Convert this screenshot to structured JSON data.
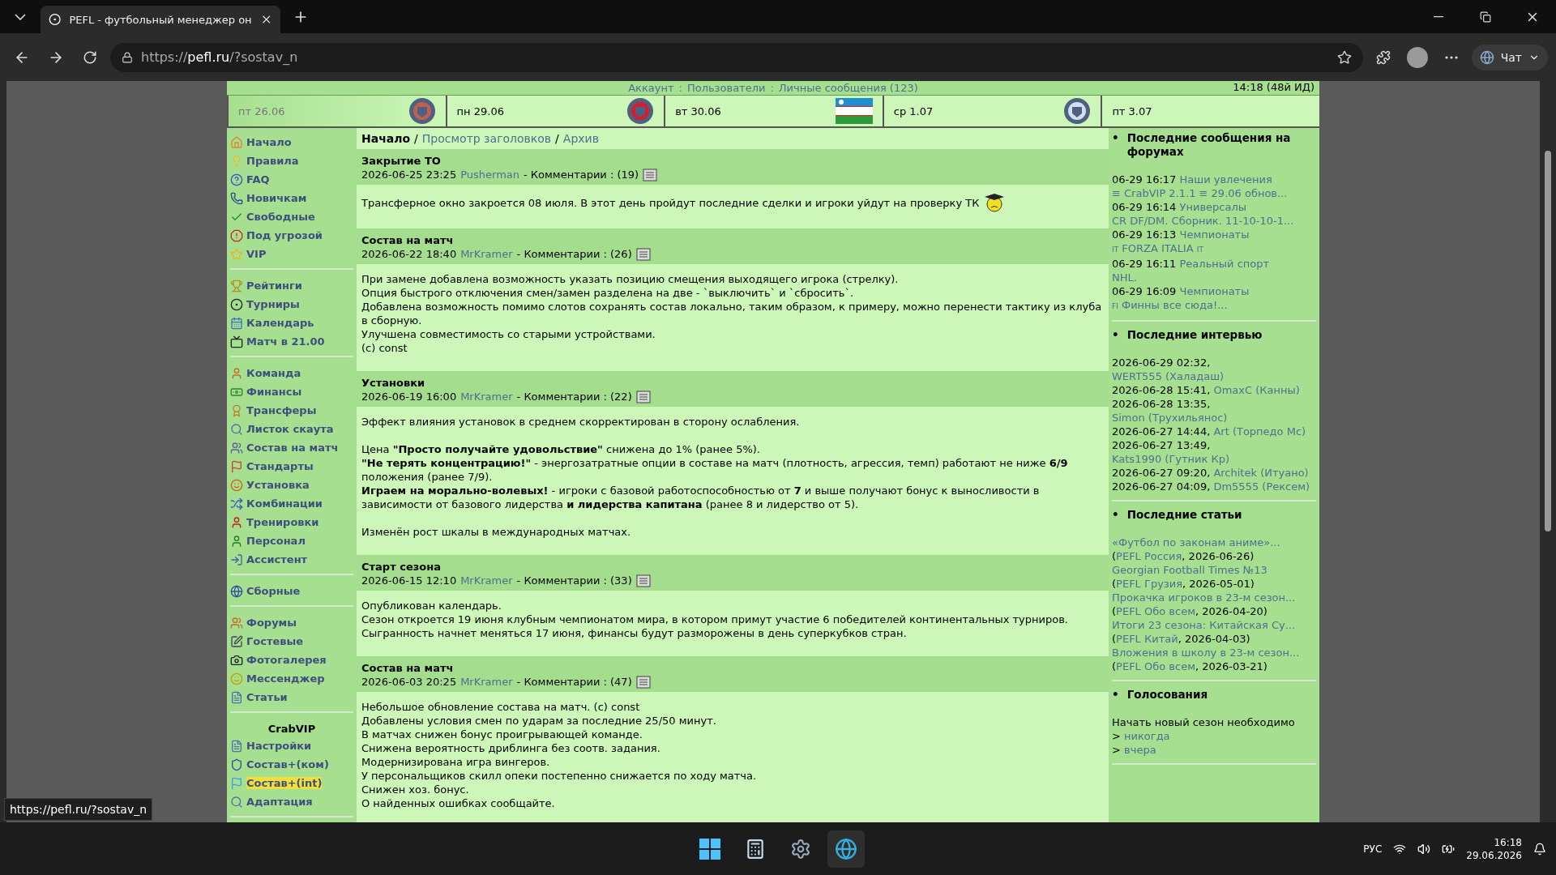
{
  "browser": {
    "tab_title": "PEFL - футбольный менеджер он",
    "url_prefix": "https://",
    "url_host": "pefl.ru",
    "url_path": "/?sostav_n",
    "chat": "Чат"
  },
  "top_nav": [
    {
      "label": "Аккаунт",
      "kind": "link"
    },
    {
      "label": ":",
      "kind": "sep"
    },
    {
      "label": "Пользователи",
      "kind": "link"
    },
    {
      "label": ":",
      "kind": "sep"
    },
    {
      "label": "Личные сообщения (123)",
      "kind": "link"
    }
  ],
  "server_time": "14:18 (48й ИД)",
  "schedule": [
    {
      "date": "пт 26.06",
      "past": true,
      "emblem": {
        "kind": "badge",
        "color": "#c06050"
      }
    },
    {
      "date": "пн 29.06",
      "past": false,
      "emblem": {
        "kind": "badge",
        "color": "#d02030"
      }
    },
    {
      "date": "вт 30.06",
      "past": false,
      "emblem": {
        "kind": "flag"
      }
    },
    {
      "date": "ср 1.07",
      "past": false,
      "emblem": {
        "kind": "badge",
        "color": "#d0e0f0"
      }
    },
    {
      "date": "пт 3.07",
      "past": false
    }
  ],
  "sidebar": [
    {
      "items": [
        {
          "label": "Начало",
          "selected": false
        },
        {
          "label": "Правила",
          "selected": false
        },
        {
          "label": "FAQ",
          "selected": false
        },
        {
          "label": "Новичкам",
          "selected": false
        },
        {
          "label": "Свободные",
          "selected": false
        },
        {
          "label": "Под угрозой",
          "selected": false
        },
        {
          "label": "VIP",
          "selected": false
        }
      ]
    },
    {
      "items": [
        {
          "label": "Рейтинги",
          "selected": false
        },
        {
          "label": "Турниры",
          "selected": false
        },
        {
          "label": "Календарь",
          "selected": false
        },
        {
          "label": "Матч в 21.00",
          "selected": false
        }
      ]
    },
    {
      "items": [
        {
          "label": "Команда",
          "selected": false
        },
        {
          "label": "Финансы",
          "selected": false
        },
        {
          "label": "Трансферы",
          "selected": false
        },
        {
          "label": "Листок скаута",
          "selected": false
        },
        {
          "label": "Состав на матч",
          "selected": false
        },
        {
          "label": "Стандарты",
          "selected": false
        },
        {
          "label": "Установка",
          "selected": false
        },
        {
          "label": "Комбинации",
          "selected": false
        },
        {
          "label": "Тренировки",
          "selected": false
        },
        {
          "label": "Персонал",
          "selected": false
        },
        {
          "label": "Ассистент",
          "selected": false
        }
      ]
    },
    {
      "items": [
        {
          "label": "Сборные",
          "selected": false
        }
      ]
    },
    {
      "items": [
        {
          "label": "Форумы",
          "selected": false
        },
        {
          "label": "Гостевые",
          "selected": false
        },
        {
          "label": "Фотогалерея",
          "selected": false
        },
        {
          "label": "Мессенджер",
          "selected": false
        },
        {
          "label": "Статьи",
          "selected": false
        }
      ]
    },
    {
      "title": "CrabVIP",
      "items": [
        {
          "label": "Настройки",
          "selected": false
        },
        {
          "label": "Состав+(ком)",
          "selected": false
        },
        {
          "label": "Состав+(int)",
          "selected": true
        },
        {
          "label": "Адаптация",
          "selected": false
        }
      ]
    }
  ],
  "breadcrumb": [
    {
      "label": "Начало",
      "kind": "current"
    },
    {
      "label": "/",
      "kind": "sep"
    },
    {
      "label": "Просмотр заголовков",
      "kind": "link"
    },
    {
      "label": "/",
      "kind": "sep"
    },
    {
      "label": "Архив",
      "kind": "link"
    }
  ],
  "news": [
    {
      "title": "Закрытие ТО",
      "date": "2026-06-25 23:25",
      "author": "Pusherman",
      "comments": "- Комментарии : (19)",
      "emoticon": true,
      "blocks": [
        [
          "Трансферное окно закроется 08 июля. В этот день пройдут последние сделки и игроки уйдут на проверку ТК"
        ]
      ]
    },
    {
      "title": "Состав на матч",
      "date": "2026-06-22 18:40",
      "author": "MrKramer",
      "comments": "- Комментарии : (26)",
      "blocks": [
        [
          "При замене добавлена возможность указать позицию смещения выходящего игрока (стрелку).",
          "Опция быстрого отключения смен/замен разделена на две - `выключить` и `сбросить`.",
          "Добавлена возможность помимо слотов сохранять состав локально, таким образом, к примеру, можно перенести тактику из клуба в сборную.",
          "Улучшена совместимость со старыми устройствами.",
          "(c) const"
        ]
      ]
    },
    {
      "title": "Установки",
      "date": "2026-06-19 16:00",
      "author": "MrKramer",
      "comments": "- Комментарии : (22)",
      "blocks": [
        [
          "Эффект влияния установок в среднем скорректирован в сторону ослабления."
        ],
        [
          "Цена **\"Просто получайте удовольствие\"** снижена до 1% (ранее 5%).",
          "**\"Не терять концентрацию!\"** - энергозатратные опции в составе на матч (плотность, агрессия, темп) работают не ниже **6/9** положения (ранее 7/9).",
          "**Играем на морально-волевых!** - игроки с базовой работоспособностью от **7** и выше получают бонус к выносливости в зависимости от базового лидерства **и лидерства капитана** (ранее 8 и лидерство от 5)."
        ],
        [
          "Изменён рост шкалы в международных матчах."
        ]
      ]
    },
    {
      "title": "Старт сезона",
      "date": "2026-06-15 12:10",
      "author": "MrKramer",
      "comments": "- Комментарии : (33)",
      "blocks": [
        [
          "Опубликован календарь.",
          "Сезон откроется 19 июня клубным чемпионатом мира, в котором примут участие 6 победителей континентальных турниров.",
          "Сыгранность начнет меняться 17 июня, финансы будут разморожены в день суперкубков стран."
        ]
      ]
    },
    {
      "title": "Состав на матч",
      "date": "2026-06-03 20:25",
      "author": "MrKramer",
      "comments": "- Комментарии : (47)",
      "blocks": [
        [
          "Небольшое обновление состава на матч. (c) const",
          "Добавлены условия смен по ударам за последние 25/50 минут.",
          "В матчах снижен бонус проигрывающей команде.",
          "Снижена вероятность дриблинга без соотв. задания.",
          "Модернизирована игра вингеров.",
          "У персональщиков скилл опеки постепенно снижается по ходу матча.",
          "Снижен хоз. бонус.",
          "О найденных ошибках сообщайте."
        ]
      ]
    }
  ],
  "forum_posts": {
    "bullet": "•",
    "title": "Последние сообщения на форумах",
    "items": [
      {
        "time": "06-29 16:17",
        "forum": "Наши увлечения",
        "topic": "≡ CrabVIP 2.1.1 ≡ 29.06 обнов..."
      },
      {
        "time": "06-29 16:14",
        "forum": "Универсалы",
        "topic": "CR DF/DM. Сборник. 11-10-10-1..."
      },
      {
        "time": "06-29 16:13",
        "forum": "Чемпионаты",
        "flag_before": "IT",
        "topic": "FORZA ITALIA",
        "flag_after": "IT"
      },
      {
        "time": "06-29 16:11",
        "forum": "Реальный спорт",
        "topic": "NHL."
      },
      {
        "time": "06-29 16:09",
        "forum": "Чемпионаты",
        "flag_before": "FI",
        "topic": "Финны все сюда!..."
      }
    ]
  },
  "interviews": {
    "bullet": "•",
    "title": "Последние интервью",
    "items": [
      {
        "time": "2026-06-29 02:32,",
        "name": "WERT555 (Халадаш)"
      },
      {
        "time": "2026-06-28 15:41,",
        "name": "OmaxC (Канны)"
      },
      {
        "time": "2026-06-28 13:35,",
        "name": "Simon (Трухильянос)"
      },
      {
        "time": "2026-06-27 14:44,",
        "name": "Art (Торпедо Мс)"
      },
      {
        "time": "2026-06-27 13:49,",
        "name": "Kats1990 (Гутник Кр)"
      },
      {
        "time": "2026-06-27 09:20,",
        "name": "Architek (Итуано)"
      },
      {
        "time": "2026-06-27 04:09,",
        "name": "Dm5555 (Рексем)"
      }
    ]
  },
  "articles": {
    "bullet": "•",
    "title": "Последние статьи",
    "items": [
      {
        "title": "«Футбол по законам аниме»...",
        "open": "(",
        "section": "PEFL Россия",
        "date": ", 2026-06-26)"
      },
      {
        "title": "Georgian Football Times №13",
        "open": "(",
        "section": "PEFL Грузия",
        "date": ", 2026-05-01)"
      },
      {
        "title": "Прокачка игроков в 23-м сезон...",
        "open": "(",
        "section": "PEFL Обо всем",
        "date": ", 2026-04-20)"
      },
      {
        "title": "Итоги 23 сезона: Китайская Су...",
        "open": "(",
        "section": "PEFL Китай",
        "date": ", 2026-04-03)"
      },
      {
        "title": "Вложения в школу в 23-м сезон...",
        "open": "(",
        "section": "PEFL Обо всем",
        "date": ", 2026-03-21)"
      }
    ]
  },
  "poll": {
    "bullet": "•",
    "title": "Голосования",
    "question": "Начать новый сезон необходимо",
    "options": [
      {
        "marker": ">",
        "label": "никогда"
      },
      {
        "marker": ">",
        "label": "вчера"
      }
    ]
  },
  "status_url": "https://pefl.ru/?sostav_n",
  "taskbar": {
    "language": "РУС",
    "time": "16:18",
    "date": "29.06.2026"
  }
}
